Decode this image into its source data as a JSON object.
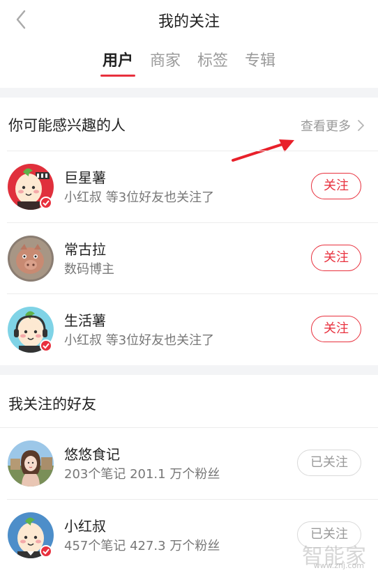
{
  "header": {
    "title": "我的关注",
    "back_icon": "chevron-left-icon"
  },
  "tabs": [
    {
      "label": "用户",
      "active": true
    },
    {
      "label": "商家",
      "active": false
    },
    {
      "label": "标签",
      "active": false
    },
    {
      "label": "专辑",
      "active": false
    }
  ],
  "suggested": {
    "title": "你可能感兴趣的人",
    "more_label": "查看更多",
    "items": [
      {
        "name": "巨星薯",
        "subtitle": "小红叔 等3位好友也关注了",
        "button": "关注",
        "verified": true
      },
      {
        "name": "常古拉",
        "subtitle": "数码博主",
        "button": "关注",
        "verified": false
      },
      {
        "name": "生活薯",
        "subtitle": "小红叔 等3位好友也关注了",
        "button": "关注",
        "verified": true
      }
    ]
  },
  "friends": {
    "title": "我关注的好友",
    "items": [
      {
        "name": "悠悠食记",
        "subtitle": "203个笔记   201.1 万个粉丝",
        "button": "已关注",
        "verified": false
      },
      {
        "name": "小红叔",
        "subtitle": "457个笔记   427.3 万个粉丝",
        "button": "已关注",
        "verified": true
      }
    ]
  },
  "colors": {
    "accent": "#e8303d",
    "divider_bg": "#f3f4f6",
    "muted_text": "#777777"
  },
  "watermark": {
    "main": "智能家",
    "sub": "www.znj.com"
  }
}
